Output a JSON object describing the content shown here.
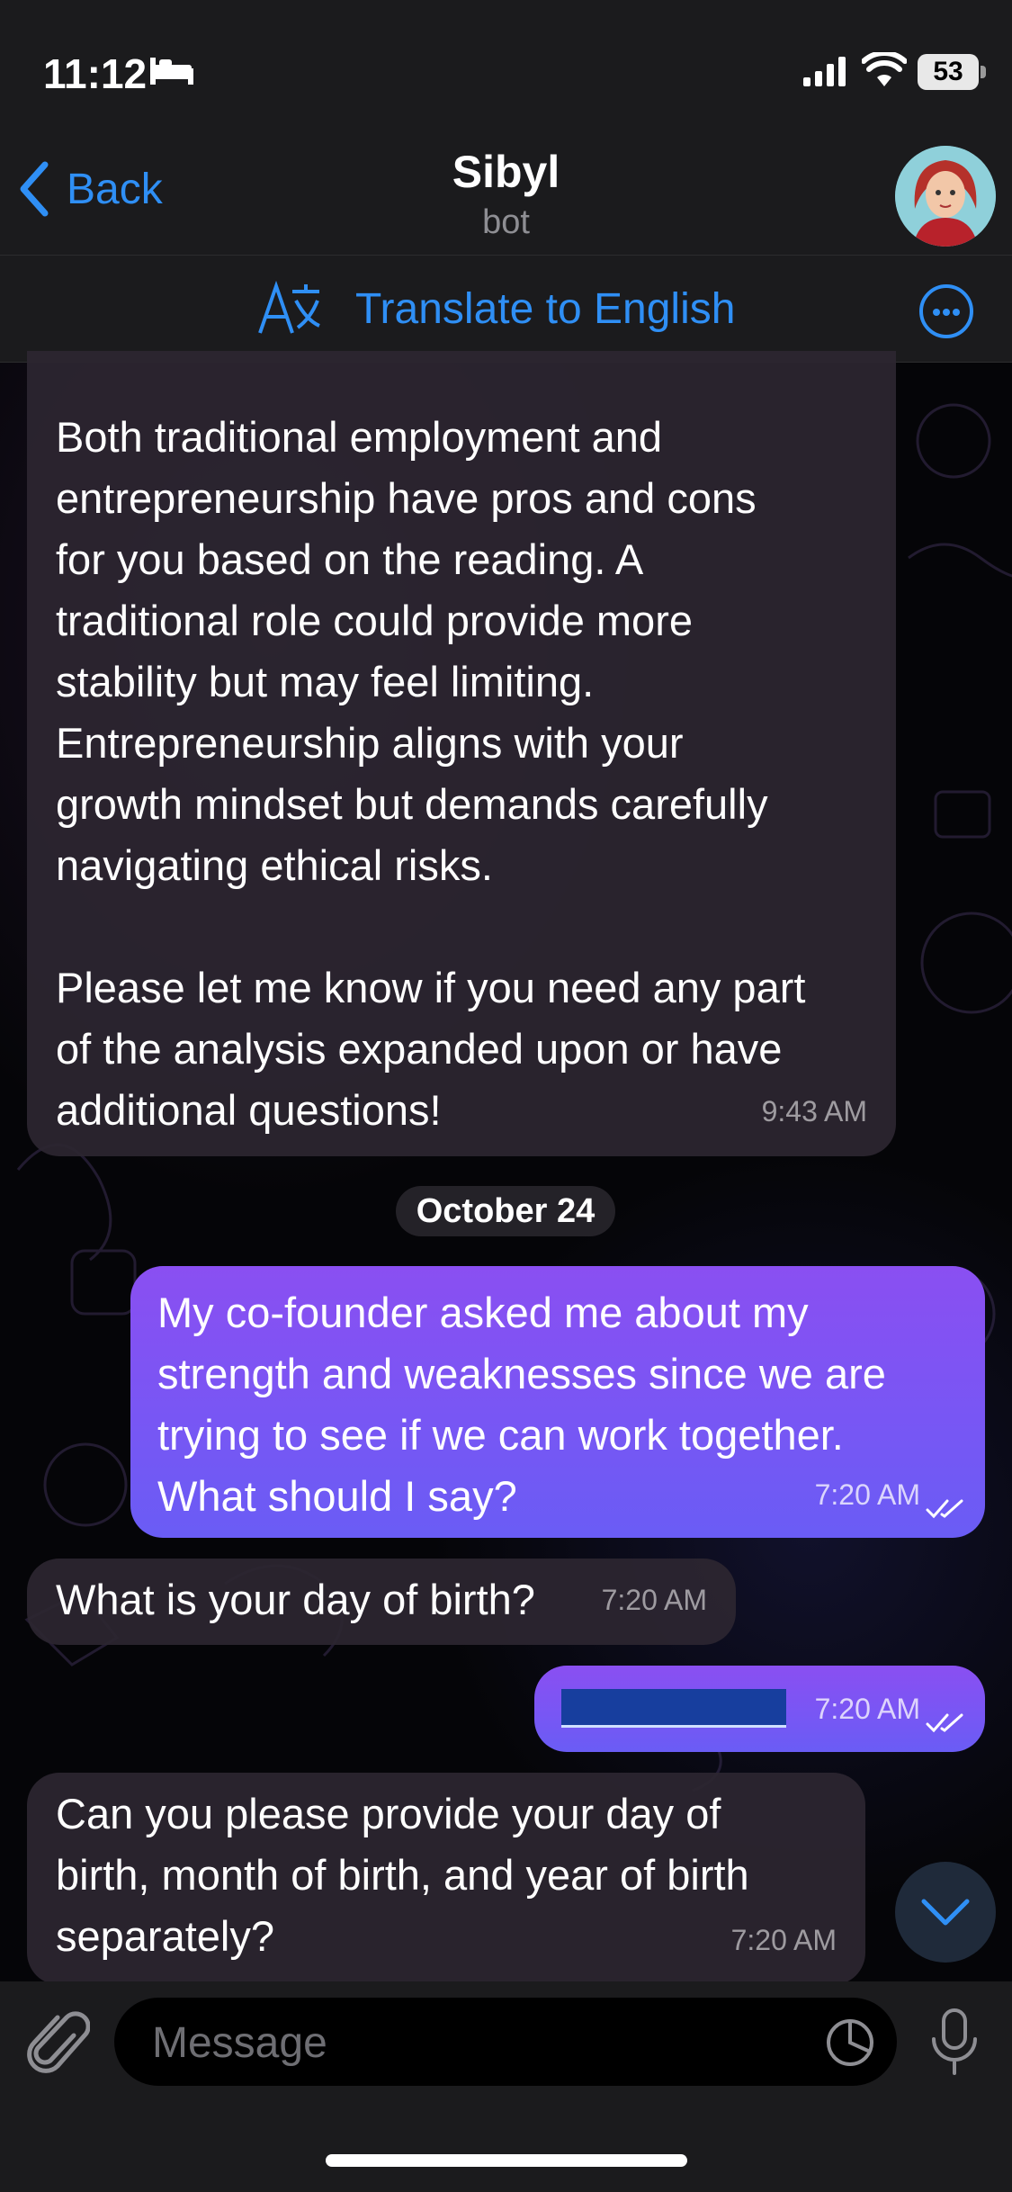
{
  "status_bar": {
    "time": "11:12",
    "battery": "53"
  },
  "header": {
    "back_label": "Back",
    "title": "Sibyl",
    "subtitle": "bot"
  },
  "translate_bar": {
    "label": "Translate to English"
  },
  "messages": {
    "m1": {
      "text": "Both traditional employment and\nentrepreneurship have pros and cons\nfor you based on the reading. A\ntraditional role could provide more\nstability but may feel limiting.\nEntrepreneurship aligns with your\ngrowth mindset but demands carefully\nnavigating ethical risks.\n\nPlease let me know if you need any part\nof the analysis expanded upon or have\nadditional questions!",
      "time": "9:43 AM"
    },
    "date_separator": "October 24",
    "m2": {
      "text": "My co-founder asked me about my\nstrength and weaknesses since we are\ntrying to see if we can work together.\nWhat should I say?",
      "time": "7:20 AM"
    },
    "m3": {
      "text": "What is your day of birth?",
      "time": "7:20 AM"
    },
    "m4": {
      "text": "",
      "time": "7:20 AM"
    },
    "m5": {
      "text": "Can you please provide your day of\nbirth, month of birth, and year of birth\nseparately?",
      "time": "7:20 AM"
    }
  },
  "input": {
    "placeholder": "Message"
  },
  "colors": {
    "accent": "#2f8ff5",
    "outgoing_bubble": "#7b55f3",
    "incoming_bubble": "#2c2630"
  }
}
